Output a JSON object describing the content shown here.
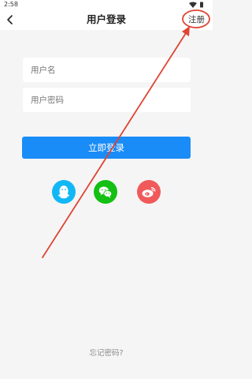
{
  "status_bar": {
    "time": "2:58"
  },
  "header": {
    "title": "用户登录",
    "register_label": "注册"
  },
  "form": {
    "username_placeholder": "用户名",
    "password_placeholder": "用户密码",
    "login_label": "立即登录"
  },
  "social": [
    {
      "name": "qq",
      "color": "#12b7f5"
    },
    {
      "name": "wechat",
      "color": "#13c013"
    },
    {
      "name": "weibo",
      "color": "#f05a5a"
    }
  ],
  "footer": {
    "forgot_label": "忘记密码?"
  },
  "annotation": {
    "color": "#e04433"
  }
}
